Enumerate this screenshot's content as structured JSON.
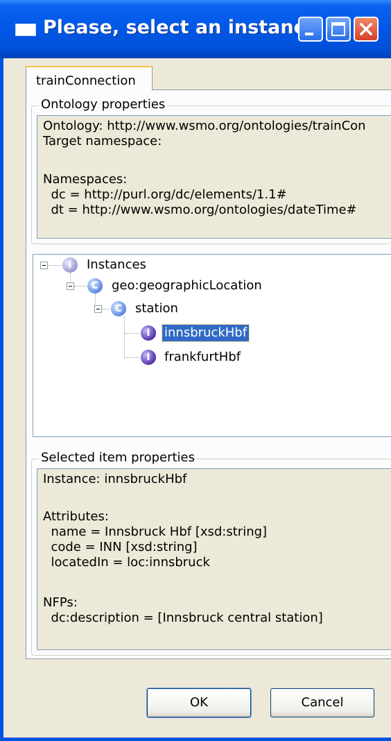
{
  "window": {
    "title": "Please, select an instance.",
    "controls": {
      "minimize_icon": "minimize-icon",
      "maximize_icon": "maximize-icon",
      "close_icon": "close-icon"
    }
  },
  "tabs": [
    {
      "label": "trainConnection",
      "selected": true
    }
  ],
  "ontology_properties": {
    "label": "Ontology properties",
    "lines": [
      "Ontology: http://www.wsmo.org/ontologies/trainCon",
      "Target namespace:",
      "",
      "Namespaces:",
      "  dc = http://purl.org/dc/elements/1.1#",
      "  dt = http://www.wsmo.org/ontologies/dateTime#"
    ]
  },
  "tree": {
    "root": {
      "label": "Instances",
      "icon": "instance-root-icon",
      "expanded": true
    },
    "class": {
      "label": "geo:geographicLocation",
      "icon": "class-icon",
      "expanded": true
    },
    "subclass": {
      "label": "station",
      "icon": "class-icon",
      "expanded": true
    },
    "instances": [
      {
        "label": "innsbruckHbf",
        "icon": "instance-icon",
        "selected": true
      },
      {
        "label": "frankfurtHbf",
        "icon": "instance-icon",
        "selected": false
      }
    ]
  },
  "selected_properties": {
    "label": "Selected item properties",
    "lines": [
      "Instance: innsbruckHbf",
      "",
      "Attributes:",
      "  name = Innsbruck Hbf [xsd:string]",
      "  code = INN [xsd:string]",
      "  locatedIn = loc:innsbruck",
      "",
      "NFPs:",
      "  dc:description = [Innsbruck central station]"
    ]
  },
  "buttons": {
    "ok": "OK",
    "cancel": "Cancel"
  },
  "colors": {
    "titlebar": "#0054e3",
    "dialog_background": "#ece9d8",
    "selection": "#316ac5"
  }
}
